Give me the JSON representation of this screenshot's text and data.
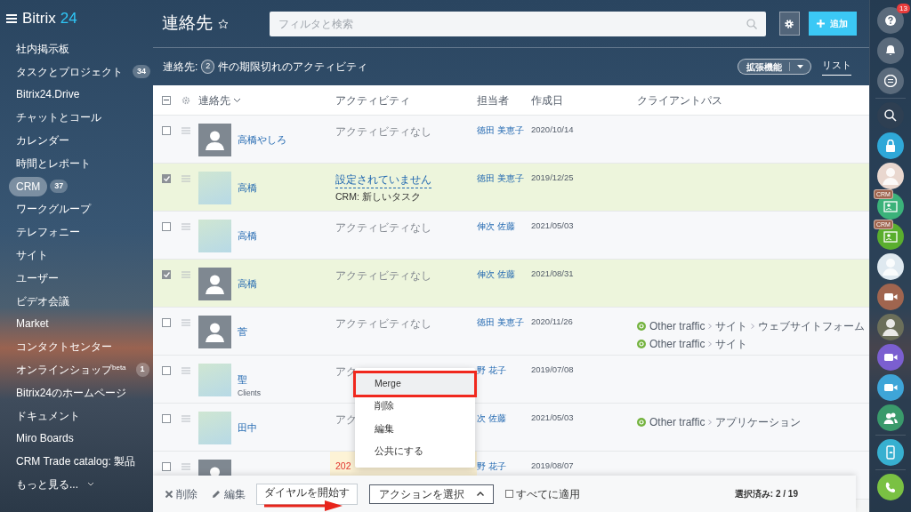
{
  "sidebar": {
    "logo": {
      "text": "Bitrix",
      "accent": "24"
    },
    "items": [
      {
        "label": "社内掲示板",
        "selected": false
      },
      {
        "label": "タスクとプロジェクト",
        "counter": "34",
        "selected": false
      },
      {
        "label": "Bitrix24.Drive",
        "selected": false
      },
      {
        "label": "チャットとコール",
        "selected": false
      },
      {
        "label": "カレンダー",
        "selected": false
      },
      {
        "label": "時間とレポート",
        "selected": false
      },
      {
        "label": "CRM",
        "counter": "37",
        "selected": true
      },
      {
        "label": "ワークグループ",
        "selected": false
      },
      {
        "label": "テレフォニー",
        "selected": false
      },
      {
        "label": "サイト",
        "selected": false
      },
      {
        "label": "ユーザー",
        "selected": false
      },
      {
        "label": "ビデオ会議",
        "selected": false
      },
      {
        "label": "Market",
        "selected": false
      },
      {
        "label": "コンタクトセンター",
        "selected": false
      },
      {
        "label": "オンラインショップ$^{beta}$",
        "counter": "1",
        "selected": false
      },
      {
        "label": "Bitrix24のホームページ",
        "selected": false
      },
      {
        "label": "ドキュメント",
        "selected": false
      },
      {
        "label": "Miro Boards",
        "selected": false
      },
      {
        "label": "CRM Trade catalog: 製品",
        "selected": false
      },
      {
        "label": "もっと見る...",
        "selected": false
      }
    ]
  },
  "header": {
    "title": "連絡先",
    "search": {
      "placeholder": "フィルタと検索"
    },
    "add_button": "追加"
  },
  "summary": {
    "prefix": "連絡先:",
    "count": "2",
    "suffix": "件の期限切れのアクティビティ"
  },
  "view": {
    "extensions_button": "拡張機能",
    "tabs": [
      {
        "label": "リスト",
        "selected": true
      }
    ]
  },
  "table": {
    "select_all_indeterminate": true,
    "columns": [
      "連絡先",
      "アクティビティ",
      "担当者",
      "作成日",
      "クライアントパス"
    ],
    "rows": [
      {
        "checked": false,
        "has_photo": false,
        "name": "高橋やしろ",
        "activity": {
          "kind": "none",
          "text": "アクティビティなし"
        },
        "responsible": "徳田 美恵子",
        "created": "2020/10/14"
      },
      {
        "checked": true,
        "has_photo": true,
        "name": "高橋",
        "activity": {
          "kind": "task",
          "text": "設定されていません",
          "detail": "CRM: 新しいタスク"
        },
        "responsible": "徳田 美恵子",
        "created": "2019/12/25"
      },
      {
        "checked": false,
        "has_photo": true,
        "name": "高橋",
        "activity": {
          "kind": "none",
          "text": "アクティビティなし"
        },
        "responsible": "伸次 佐藤",
        "created": "2021/05/03"
      },
      {
        "checked": true,
        "has_photo": false,
        "name": "高橋",
        "activity": {
          "kind": "none",
          "text": "アクティビティなし"
        },
        "responsible": "伸次 佐藤",
        "created": "2021/08/31"
      },
      {
        "checked": false,
        "has_photo": false,
        "name": "菅",
        "activity": {
          "kind": "none",
          "text": "アクティビティなし"
        },
        "responsible": "徳田 美恵子",
        "created": "2020/11/26",
        "client_path": [
          [
            "Other traffic",
            "サイト",
            "ウェブサイトフォーム"
          ],
          [
            "Other traffic",
            "サイト"
          ]
        ]
      },
      {
        "checked": false,
        "has_photo": true,
        "name": "聖",
        "subtitle": "Clients",
        "activity": {
          "kind": "none",
          "text": "アク"
        },
        "responsible": "野 花子",
        "created": "2019/07/08"
      },
      {
        "checked": false,
        "has_photo": true,
        "name": "田中",
        "activity": {
          "kind": "none",
          "text": "アク"
        },
        "responsible": "次 佐藤",
        "created": "2021/05/03",
        "client_path": [
          [
            "Other traffic",
            "アプリケーション"
          ]
        ]
      },
      {
        "checked": false,
        "has_photo": false,
        "activity": {
          "kind": "overdue",
          "text": "202"
        },
        "responsible": "野 花子",
        "created": "2019/08/07"
      }
    ]
  },
  "context_menu": [
    {
      "label": "Merge",
      "selected": true
    },
    {
      "label": "削除",
      "selected": false
    },
    {
      "label": "編集",
      "selected": false
    },
    {
      "label": "公共にする",
      "selected": false
    }
  ],
  "action_bar": {
    "delete": "削除",
    "edit": "編集",
    "dial_button": "ダイヤルを開始す",
    "action_button": "アクションを選択",
    "apply_all": {
      "label": "すべてに適用",
      "checked": false
    },
    "selected_count": "選択済み: 2 / 19"
  },
  "right_rail": [
    {
      "kind": "help",
      "color": "#5b6b7c",
      "badge": "13"
    },
    {
      "kind": "bell",
      "color": "#5b6b7c"
    },
    {
      "kind": "chat",
      "color": "#5b6b7c"
    },
    {
      "kind": "search",
      "color": "#2e3f52"
    },
    {
      "kind": "lock",
      "color": "#2fa8d8"
    },
    {
      "kind": "avatar",
      "color": "#e9d7cf"
    },
    {
      "kind": "crm",
      "color": "#3bb27a",
      "tag": "CRM"
    },
    {
      "kind": "crm",
      "color": "#5aae2e",
      "tag": "CRM"
    },
    {
      "kind": "avatar",
      "color": "#dfe9f0"
    },
    {
      "kind": "video",
      "color": "#a0654f"
    },
    {
      "kind": "avatar",
      "color": "#6b6f5a"
    },
    {
      "kind": "video",
      "color": "#7b5fd0"
    },
    {
      "kind": "video",
      "color": "#3ea5d8"
    },
    {
      "kind": "group",
      "color": "#3a9a6b"
    },
    {
      "kind": "cloud-phone",
      "color": "#37b0d0"
    },
    {
      "kind": "phone",
      "color": "#7ac143"
    }
  ]
}
